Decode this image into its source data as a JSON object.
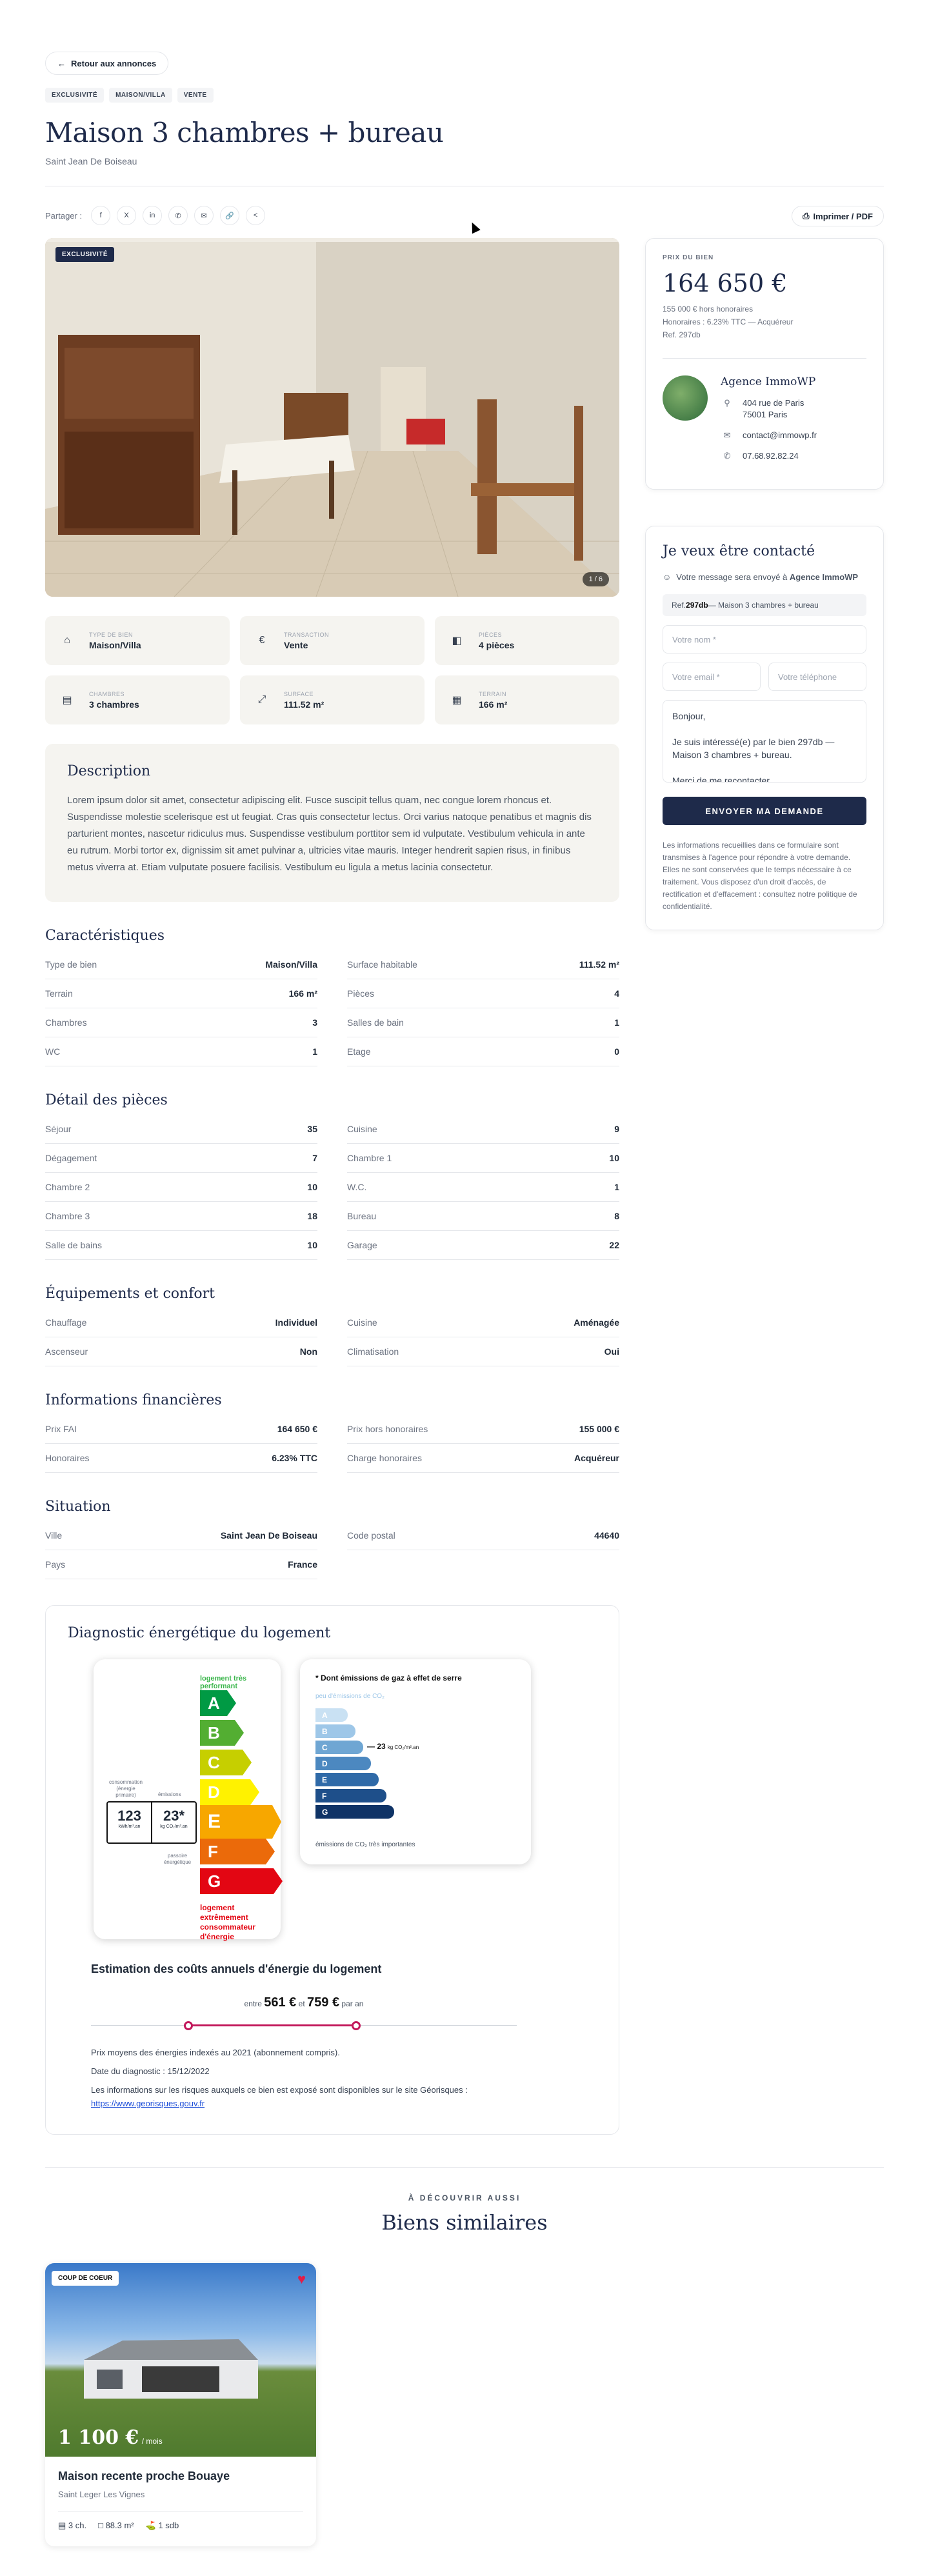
{
  "back_label": "Retour aux annonces",
  "tags": [
    "EXCLUSIVITÉ",
    "MAISON/VILLA",
    "VENTE"
  ],
  "title": "Maison 3 chambres + bureau",
  "city": "Saint Jean De Boiseau",
  "share_label": "Partager :",
  "share_icons": [
    "facebook-icon",
    "x-icon",
    "linkedin-icon",
    "whatsapp-icon",
    "mail-icon",
    "link-icon",
    "share-icon"
  ],
  "print_label": "Imprimer / PDF",
  "gallery": {
    "badge": "EXCLUSIVITÉ",
    "counter": "1 / 6"
  },
  "facts": [
    {
      "icon": "home-icon",
      "label": "TYPE DE BIEN",
      "value": "Maison/Villa"
    },
    {
      "icon": "euro-icon",
      "label": "TRANSACTION",
      "value": "Vente"
    },
    {
      "icon": "door-icon",
      "label": "PIÈCES",
      "value": "4 pièces"
    },
    {
      "icon": "bed-icon",
      "label": "CHAMBRES",
      "value": "3 chambres"
    },
    {
      "icon": "expand-icon",
      "label": "SURFACE",
      "value": "111.52 m²"
    },
    {
      "icon": "land-icon",
      "label": "TERRAIN",
      "value": "166 m²"
    }
  ],
  "description": {
    "title": "Description",
    "text": "Lorem ipsum dolor sit amet, consectetur adipiscing elit. Fusce suscipit tellus quam, nec congue lorem rhoncus et. Suspendisse molestie scelerisque est ut feugiat. Cras quis consectetur lectus. Orci varius natoque penatibus et magnis dis parturient montes, nascetur ridiculus mus. Suspendisse vestibulum porttitor sem id vulputate. Vestibulum vehicula in ante eu rutrum. Morbi tortor ex, dignissim sit amet pulvinar a, ultricies vitae mauris. Integer hendrerit sapien risus, in finibus metus viverra at. Etiam vulputate posuere facilisis. Vestibulum eu ligula a metus lacinia consectetur."
  },
  "sections": [
    {
      "title": "Caractéristiques",
      "rows": [
        [
          "Type de bien",
          "Maison/Villa"
        ],
        [
          "Surface habitable",
          "111.52 m²"
        ],
        [
          "Terrain",
          "166 m²"
        ],
        [
          "Pièces",
          "4"
        ],
        [
          "Chambres",
          "3"
        ],
        [
          "Salles de bain",
          "1"
        ],
        [
          "WC",
          "1"
        ],
        [
          "Etage",
          "0"
        ]
      ]
    },
    {
      "title": "Détail des pièces",
      "rows": [
        [
          "Séjour",
          "35"
        ],
        [
          "Cuisine",
          "9"
        ],
        [
          "Dégagement",
          "7"
        ],
        [
          "Chambre 1",
          "10"
        ],
        [
          "Chambre 2",
          "10"
        ],
        [
          "W.C.",
          "1"
        ],
        [
          "Chambre 3",
          "18"
        ],
        [
          "Bureau",
          "8"
        ],
        [
          "Salle de bains",
          "10"
        ],
        [
          "Garage",
          "22"
        ]
      ]
    },
    {
      "title": "Équipements et confort",
      "rows": [
        [
          "Chauffage",
          "Individuel"
        ],
        [
          "Cuisine",
          "Aménagée"
        ],
        [
          "Ascenseur",
          "Non"
        ],
        [
          "Climatisation",
          "Oui"
        ]
      ]
    },
    {
      "title": "Informations financières",
      "rows": [
        [
          "Prix FAI",
          "164 650 €"
        ],
        [
          "Prix hors honoraires",
          "155 000 €"
        ],
        [
          "Honoraires",
          "6.23% TTC"
        ],
        [
          "Charge honoraires",
          "Acquéreur"
        ]
      ]
    },
    {
      "title": "Situation",
      "rows": [
        [
          "Ville",
          "Saint Jean De Boiseau"
        ],
        [
          "Code postal",
          "44640"
        ],
        [
          "Pays",
          "France"
        ],
        [
          "",
          ""
        ]
      ]
    }
  ],
  "price_card": {
    "label": "PRIX DU BIEN",
    "price": "164 650 €",
    "sub1": "155 000 € hors honoraires",
    "sub2": "Honoraires : 6.23% TTC — Acquéreur",
    "sub3": "Ref. 297db",
    "agency": "Agence ImmoWP",
    "address1": "404 rue de Paris",
    "address2": "75001 Paris",
    "email": "contact@immowp.fr",
    "phone": "07.68.92.82.24"
  },
  "contact": {
    "title": "Je veux être contacté",
    "note_prefix": "Votre message sera envoyé à ",
    "note_agency": "Agence ImmoWP",
    "ref_prefix": "Ref. ",
    "ref_code": "297db",
    "ref_suffix": " — Maison 3 chambres + bureau",
    "name_placeholder": "Votre nom *",
    "email_placeholder": "Votre email *",
    "phone_placeholder": "Votre téléphone",
    "message": "Bonjour,\n\nJe suis intéressé(e) par le bien 297db — Maison 3 chambres + bureau.\n\nMerci de me recontacter",
    "submit": "ENVOYER MA DEMANDE",
    "legal": "Les informations recueillies dans ce formulaire sont transmises à l'agence pour répondre à votre demande. Elles ne sont conservées que le temps nécessaire à ce traitement. Vous disposez d'un droit d'accès, de rectification et d'effacement : consultez notre politique de confidentialité."
  },
  "dpe": {
    "title": "Diagnostic énergétique du logement",
    "energy_top": "logement très performant",
    "energy_bottom": "logement extrêmement consommateur d'énergie",
    "energy_classes": [
      "A",
      "B",
      "C",
      "D",
      "E",
      "F",
      "G"
    ],
    "energy_colors": [
      "#009a44",
      "#53ae32",
      "#c6cf00",
      "#fff200",
      "#f7a700",
      "#eb6a0a",
      "#e30613"
    ],
    "current_class": "E",
    "consumption_label": "consommation (énergie primaire)",
    "consumption_value": "123",
    "consumption_unit": "kWh/m².an",
    "emissions_label": "émissions",
    "emissions_value": "23*",
    "emissions_unit": "kg CO₂/m².an",
    "passoire_label": "passoire énergétique",
    "ges_title": "* Dont émissions de gaz à effet de serre",
    "ges_top": "peu d'émissions de CO₂",
    "ges_bottom": "émissions de CO₂ très importantes",
    "ges_classes": [
      "A",
      "B",
      "C",
      "D",
      "E",
      "F",
      "G"
    ],
    "ges_colors": [
      "#c9e1f3",
      "#9ec7e8",
      "#6fa6d3",
      "#4c88c0",
      "#2f6aa8",
      "#1e4f8a",
      "#0f3366"
    ],
    "ges_current": "C",
    "ges_value": "23",
    "ges_unit": "kg CO₂/m².an",
    "cost_title": "Estimation des coûts annuels d'énergie du logement",
    "cost_between": "entre",
    "cost_min": "561 €",
    "cost_and": "et",
    "cost_max": "759 €",
    "cost_per": "par an",
    "line1": "Prix moyens des énergies indexés au 2021 (abonnement compris).",
    "line2": "Date du diagnostic : 15/12/2022",
    "line3": "Les informations sur les risques auxquels ce bien est exposé sont disponibles sur le site Géorisques :",
    "link": "https://www.georisques.gouv.fr"
  },
  "similar": {
    "kicker": "À DÉCOUVRIR AUSSI",
    "title": "Biens similaires",
    "card": {
      "badge": "COUP DE COEUR",
      "price": "1 100 €",
      "price_unit": "/ mois",
      "name": "Maison recente proche Bouaye",
      "location": "Saint Leger Les Vignes",
      "beds": "3 ch.",
      "surface": "88.3 m²",
      "baths": "1 sdb"
    }
  }
}
